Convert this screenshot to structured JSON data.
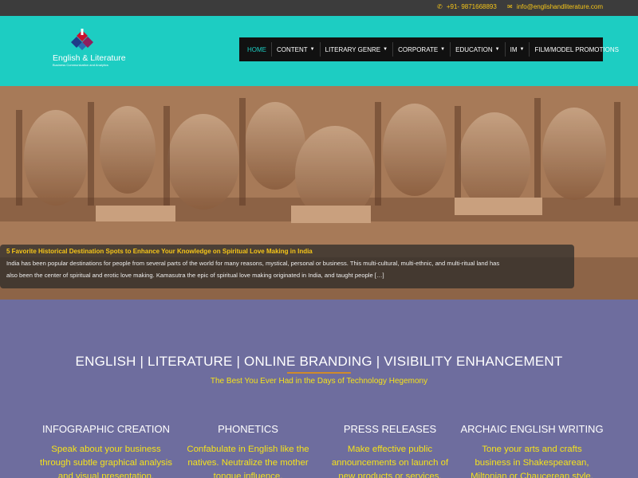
{
  "topbar": {
    "phone_icon": "phone-icon",
    "phone": "+91- 9871668893",
    "email_icon": "envelope-icon",
    "email": "info@englishandliterature.com"
  },
  "logo": {
    "brand": "English & Literature",
    "tagline": "Business Communication and Analytics"
  },
  "nav": {
    "items": [
      {
        "label": "HOME",
        "dropdown": false,
        "active": true
      },
      {
        "label": "CONTENT",
        "dropdown": true
      },
      {
        "label": "LITERARY GENRE",
        "dropdown": true
      },
      {
        "label": "CORPORATE",
        "dropdown": true
      },
      {
        "label": "EDUCATION",
        "dropdown": true
      },
      {
        "label": "IM",
        "dropdown": true
      },
      {
        "label": "FILM/MODEL PROMOTIONS",
        "dropdown": false
      }
    ]
  },
  "slider": {
    "title": "5 Favorite Historical Destination Spots to Enhance Your Knowledge on Spiritual Love Making in India",
    "line1": "India has been popular destinations for people from several parts of the world for many reasons, mystical, personal or business.  This multi-cultural, multi-ethnic, and multi-ritual land has",
    "line2": "also been the center of spiritual and erotic love making. Kamasutra the epic of spiritual love making originated in India, and taught people […]"
  },
  "services": {
    "headline": "ENGLISH | LITERATURE | ONLINE BRANDING | VISIBILITY ENHANCEMENT",
    "subline": "The Best You Ever Had in the Days of Technology Hegemony",
    "columns": [
      {
        "title": "INFOGRAPHIC CREATION",
        "l1": "Speak about your business",
        "l2": "through subtle graphical analysis",
        "l3": "and visual presentation."
      },
      {
        "title": "PHONETICS",
        "l1": "Confabulate in English like the",
        "l2": "natives. Neutralize the mother",
        "l3": "tongue influence."
      },
      {
        "title": "PRESS RELEASES",
        "l1": "Make effective public",
        "l2": "announcements on launch of",
        "l3": "new products or services."
      },
      {
        "title": "ARCHAIC ENGLISH WRITING",
        "l1": "Tone your arts and crafts",
        "l2": "business in Shakespearean,",
        "l3": "Miltonian or Chaucerean style."
      }
    ]
  },
  "colors": {
    "header_bg": "#1dcdc2",
    "topbar_bg": "#3c3c3c",
    "nav_bg": "#111111",
    "section_bg": "#6e6d9e",
    "accent_yellow": "#f5e21b"
  }
}
